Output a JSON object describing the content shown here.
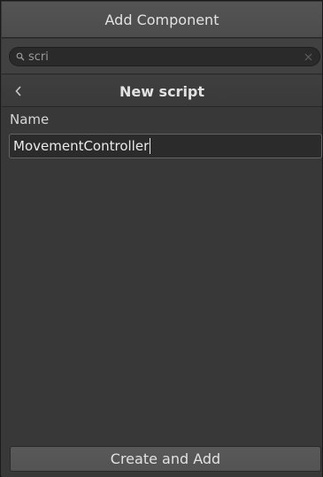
{
  "window": {
    "title": "Add Component"
  },
  "search": {
    "value": "scri",
    "icon": "search-icon",
    "clear_icon": "close-icon"
  },
  "nav": {
    "back_icon": "chevron-left-icon",
    "title": "New script"
  },
  "form": {
    "name_label": "Name",
    "name_value": "MovementController"
  },
  "footer": {
    "create_label": "Create and Add"
  },
  "colors": {
    "window_bg": "#383838",
    "titlebar_bg": "#545454",
    "field_bg": "#2b2b2b",
    "field_border": "#646464",
    "button_bg": "#595959",
    "text": "#d2d2d2"
  }
}
